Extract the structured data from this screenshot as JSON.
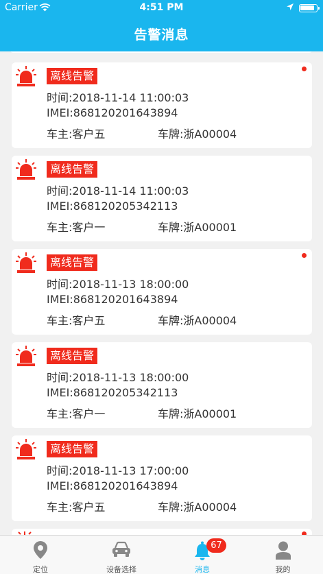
{
  "status_bar": {
    "carrier": "Carrier",
    "time": "4:51 PM"
  },
  "header": {
    "title": "告警消息"
  },
  "alarms": [
    {
      "badge": "离线告警",
      "time": "时间:2018-11-14 11:00:03",
      "imei": "IMEI:868120201643894",
      "owner": "车主:客户五",
      "plate": "车牌:浙A00004",
      "unread": true
    },
    {
      "badge": "离线告警",
      "time": "时间:2018-11-14 11:00:03",
      "imei": "IMEI:868120205342113",
      "owner": "车主:客户一",
      "plate": "车牌:浙A00001",
      "unread": false
    },
    {
      "badge": "离线告警",
      "time": "时间:2018-11-13 18:00:00",
      "imei": "IMEI:868120201643894",
      "owner": "车主:客户五",
      "plate": "车牌:浙A00004",
      "unread": true
    },
    {
      "badge": "离线告警",
      "time": "时间:2018-11-13 18:00:00",
      "imei": "IMEI:868120205342113",
      "owner": "车主:客户一",
      "plate": "车牌:浙A00001",
      "unread": false
    },
    {
      "badge": "离线告警",
      "time": "时间:2018-11-13 17:00:00",
      "imei": "IMEI:868120201643894",
      "owner": "车主:客户五",
      "plate": "车牌:浙A00004",
      "unread": false
    }
  ],
  "tabs": {
    "location": {
      "label": "定位",
      "icon": "location-pin-icon"
    },
    "device": {
      "label": "设备选择",
      "icon": "car-icon"
    },
    "messages": {
      "label": "消息",
      "icon": "bell-icon",
      "badge": "67"
    },
    "mine": {
      "label": "我的",
      "icon": "person-icon"
    }
  },
  "colors": {
    "header": "#1ab6ee",
    "alarm_red": "#f02b1d",
    "active_tab": "#1ab6ee"
  }
}
